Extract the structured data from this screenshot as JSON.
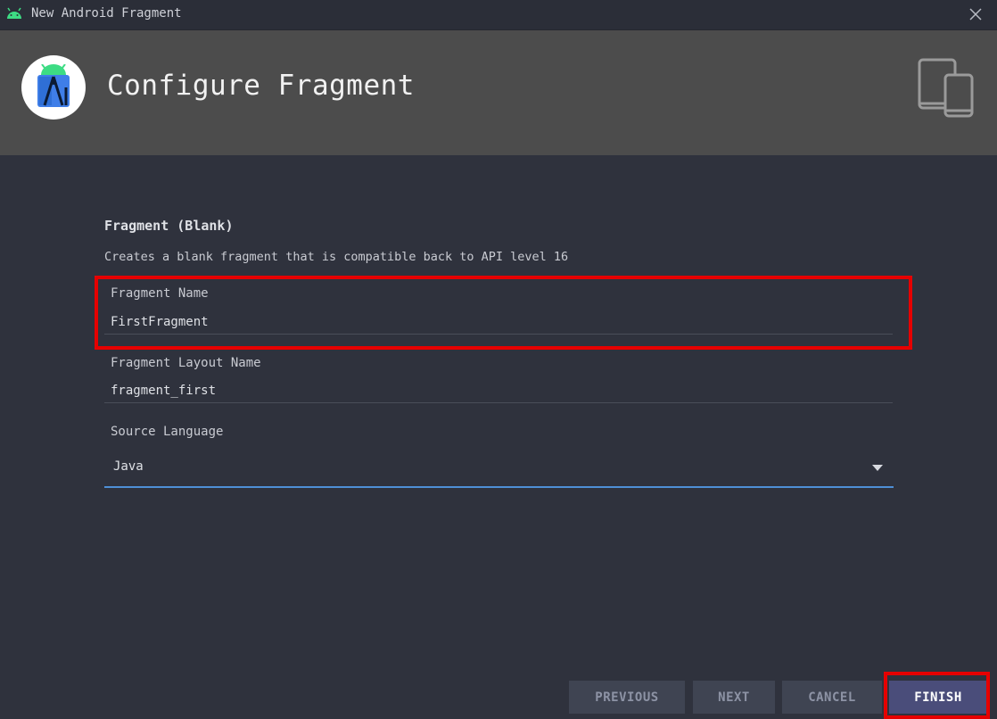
{
  "window": {
    "title": "New Android Fragment",
    "icon": "android-icon",
    "close_icon": "close-icon"
  },
  "header": {
    "title": "Configure Fragment",
    "logo_icon": "android-studio-logo",
    "devices_icon": "devices-icon",
    "background": "#4c4c4c"
  },
  "template": {
    "name": "Fragment (Blank)",
    "description": "Creates a blank fragment that is compatible back to API level 16"
  },
  "fields": {
    "fragment_name": {
      "label": "Fragment Name",
      "value": "FirstFragment"
    },
    "layout_name": {
      "label": "Fragment Layout Name",
      "value": "fragment_first"
    },
    "source_language": {
      "label": "Source Language",
      "value": "Java"
    }
  },
  "buttons": {
    "previous": "PREVIOUS",
    "next": "NEXT",
    "cancel": "CANCEL",
    "finish": "FINISH"
  },
  "colors": {
    "highlight": "#e60000",
    "accent": "#4e8fd6",
    "primary_button": "#4a4d7a"
  }
}
